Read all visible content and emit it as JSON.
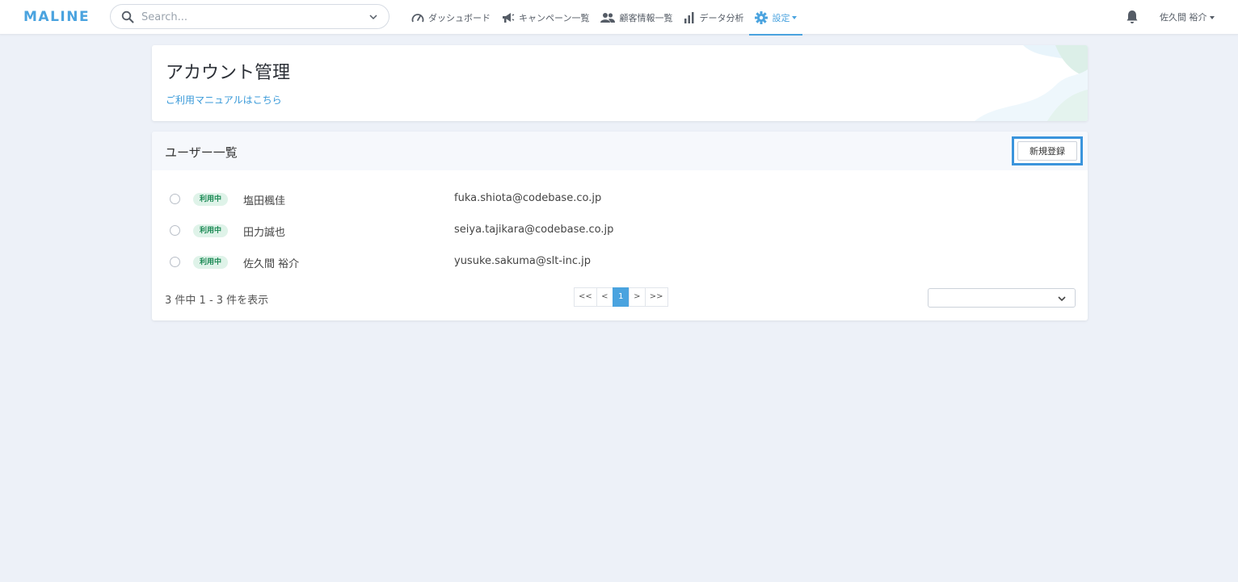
{
  "nav": {
    "logo": "MALINE",
    "search_placeholder": "Search...",
    "items": [
      {
        "label": "ダッシュボード",
        "icon": "gauge-icon"
      },
      {
        "label": "キャンペーン一覧",
        "icon": "megaphone-icon"
      },
      {
        "label": "顧客情報一覧",
        "icon": "users-icon"
      },
      {
        "label": "データ分析",
        "icon": "bar-chart-icon"
      },
      {
        "label": "設定",
        "icon": "gear-icon",
        "active": true
      }
    ],
    "user": "佐久間 裕介"
  },
  "header": {
    "title": "アカウント管理",
    "manual_link": "ご利用マニュアルはこちら"
  },
  "users": {
    "section_title": "ユーザー一覧",
    "new_button": "新規登録",
    "rows": [
      {
        "status": "利用中",
        "name": "塩田楓佳",
        "email": "fuka.shiota@codebase.co.jp"
      },
      {
        "status": "利用中",
        "name": "田力誠也",
        "email": "seiya.tajikara@codebase.co.jp"
      },
      {
        "status": "利用中",
        "name": "佐久間 裕介",
        "email": "yusuke.sakuma@slt-inc.jp"
      }
    ],
    "count_text": "3 件中 1 - 3 件を表示",
    "pagination": {
      "first": "<<",
      "prev": "<",
      "current": "1",
      "next": ">",
      "last": ">>"
    },
    "per_page_value": ""
  },
  "colors": {
    "accent": "#4aa3df",
    "badge_bg": "#dff3e9",
    "badge_text": "#1c8a55",
    "highlight_frame": "#3a94dc",
    "page_bg": "#edf1f8"
  }
}
